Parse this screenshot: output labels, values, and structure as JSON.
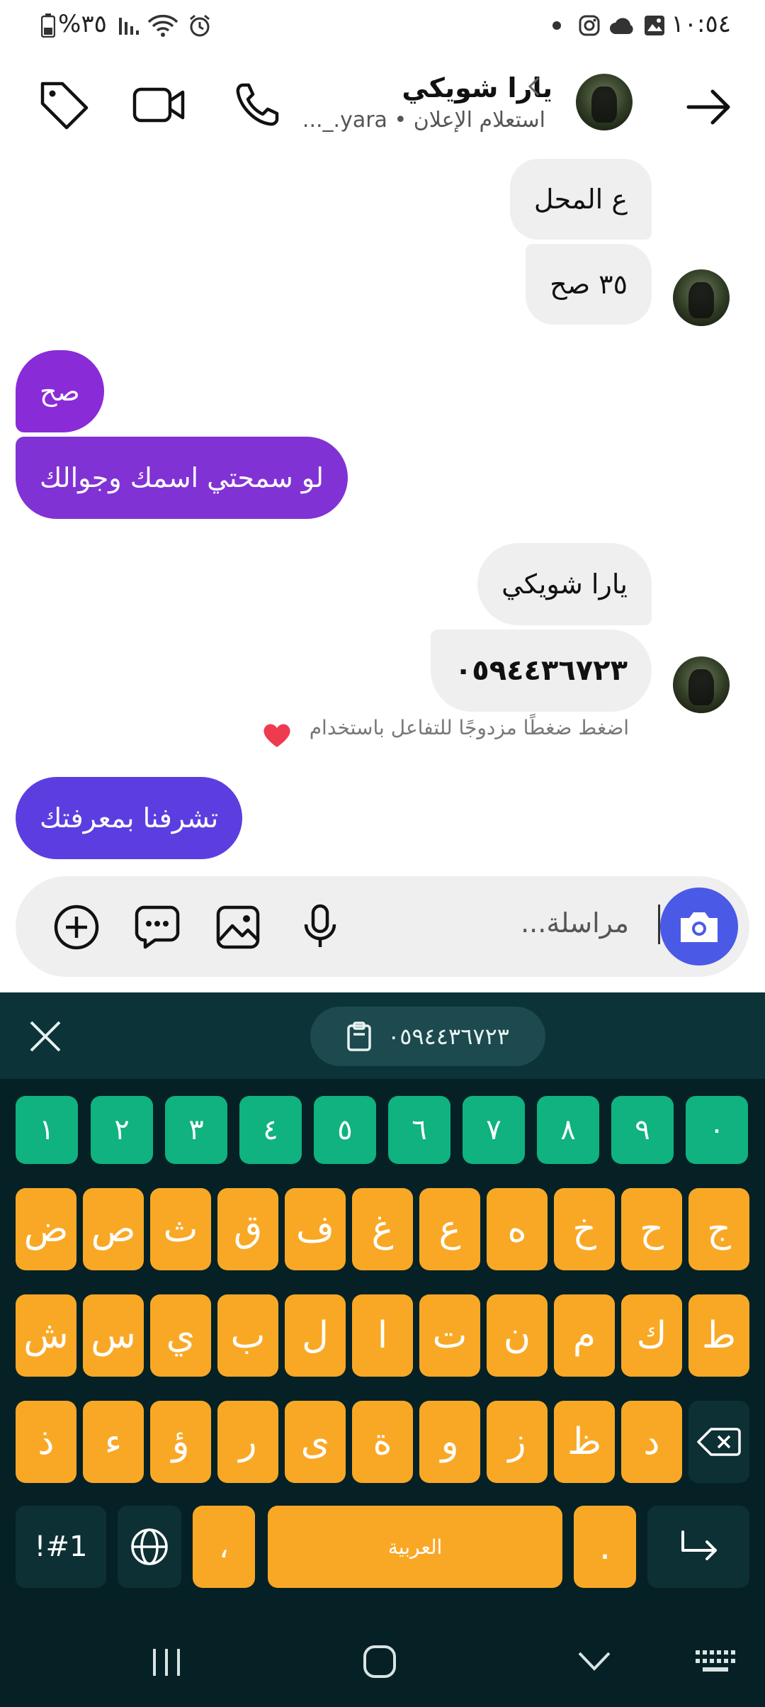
{
  "status_bar": {
    "time": "١٠:٥٤",
    "battery": "%٣٥"
  },
  "header": {
    "name": "يارا شويكي",
    "subtitle": "استعلام الإعلان • yara._..."
  },
  "messages": [
    {
      "text": "ع المحل",
      "sender": "them"
    },
    {
      "text": "٣٥ صح",
      "sender": "them"
    },
    {
      "text": "صح",
      "sender": "me"
    },
    {
      "text": "لو سمحتي اسمك وجوالك",
      "sender": "me"
    },
    {
      "text": "يارا شويكي",
      "sender": "them"
    },
    {
      "text": "٠٥٩٤٤٣٦٧٢٣",
      "sender": "them"
    },
    {
      "text": "تشرفنا بمعرفتك",
      "sender": "me"
    }
  ],
  "reaction_hint": "اضغط ضغطًا مزدوجًا للتفاعل باستخدام",
  "composer": {
    "placeholder": "مراسلة..."
  },
  "keyboard": {
    "clipboard_item": "٠٥٩٤٤٣٦٧٢٣",
    "numbers": [
      "١",
      "٢",
      "٣",
      "٤",
      "٥",
      "٦",
      "٧",
      "٨",
      "٩",
      "٠"
    ],
    "row1": [
      "ض",
      "ص",
      "ث",
      "ق",
      "ف",
      "غ",
      "ع",
      "ه",
      "خ",
      "ح",
      "ج"
    ],
    "row2": [
      "ش",
      "س",
      "ي",
      "ب",
      "ل",
      "ا",
      "ت",
      "ن",
      "م",
      "ك",
      "ط"
    ],
    "row3": [
      "ذ",
      "ء",
      "ؤ",
      "ر",
      "ى",
      "ة",
      "و",
      "ز",
      "ظ",
      "د"
    ],
    "symbols_key": "!#1",
    "comma_key": "،",
    "space_label": "العربية",
    "period_key": "."
  },
  "colors": {
    "accent_blue": "#4a5ae6",
    "bubble_purple": "#8a2bd8",
    "keyboard_bg": "#052126",
    "number_keys": "#10b27f",
    "letter_keys": "#f9a825"
  }
}
